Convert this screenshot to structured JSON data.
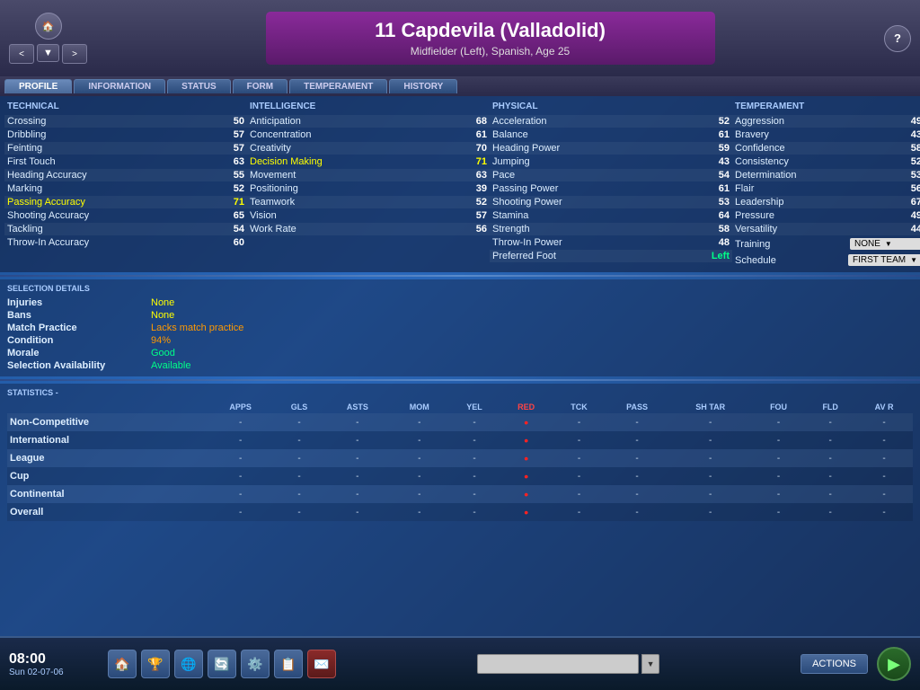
{
  "header": {
    "nav_back": "<",
    "nav_forward": ">",
    "player_number": "11",
    "player_name": "Capdevila (Valladolid)",
    "player_subtitle": "Midfielder (Left), Spanish, Age 25",
    "dropdown_arrow": "▼",
    "help": "?"
  },
  "tabs": {
    "profile": "PROFILE",
    "information": "INFORMATION",
    "status": "STATUS",
    "form": "FORM",
    "temperament": "TEMPERAMENT",
    "history": "HISTORY"
  },
  "technical": {
    "label": "TECHNICAL",
    "stats": [
      {
        "name": "Crossing",
        "value": "50",
        "highlight": false
      },
      {
        "name": "Dribbling",
        "value": "57",
        "highlight": false
      },
      {
        "name": "Feinting",
        "value": "57",
        "highlight": false
      },
      {
        "name": "First Touch",
        "value": "63",
        "highlight": false
      },
      {
        "name": "Heading Accuracy",
        "value": "55",
        "highlight": false
      },
      {
        "name": "Marking",
        "value": "52",
        "highlight": false
      },
      {
        "name": "Passing Accuracy",
        "value": "71",
        "highlight": true
      },
      {
        "name": "Shooting Accuracy",
        "value": "65",
        "highlight": false
      },
      {
        "name": "Tackling",
        "value": "54",
        "highlight": false
      },
      {
        "name": "Throw-In Accuracy",
        "value": "60",
        "highlight": false
      }
    ]
  },
  "intelligence": {
    "label": "INTELLIGENCE",
    "stats": [
      {
        "name": "Anticipation",
        "value": "68",
        "highlight": false
      },
      {
        "name": "Concentration",
        "value": "61",
        "highlight": false
      },
      {
        "name": "Creativity",
        "value": "70",
        "highlight": false
      },
      {
        "name": "Decision Making",
        "value": "71",
        "highlight": true
      },
      {
        "name": "Movement",
        "value": "63",
        "highlight": false
      },
      {
        "name": "Positioning",
        "value": "39",
        "highlight": false
      },
      {
        "name": "Teamwork",
        "value": "52",
        "highlight": false
      },
      {
        "name": "Vision",
        "value": "57",
        "highlight": false
      },
      {
        "name": "Work Rate",
        "value": "56",
        "highlight": false
      }
    ]
  },
  "physical": {
    "label": "PHYSICAL",
    "stats": [
      {
        "name": "Acceleration",
        "value": "52",
        "highlight": false
      },
      {
        "name": "Balance",
        "value": "61",
        "highlight": false
      },
      {
        "name": "Heading Power",
        "value": "59",
        "highlight": false
      },
      {
        "name": "Jumping",
        "value": "43",
        "highlight": false
      },
      {
        "name": "Pace",
        "value": "54",
        "highlight": false
      },
      {
        "name": "Passing Power",
        "value": "61",
        "highlight": false
      },
      {
        "name": "Shooting Power",
        "value": "53",
        "highlight": false
      },
      {
        "name": "Stamina",
        "value": "64",
        "highlight": false
      },
      {
        "name": "Strength",
        "value": "58",
        "highlight": false
      },
      {
        "name": "Throw-In Power",
        "value": "48",
        "highlight": false
      },
      {
        "name": "Preferred Foot",
        "value": "Left",
        "highlight": true,
        "green": true
      }
    ]
  },
  "temperament": {
    "label": "TEMPERAMENT",
    "stats": [
      {
        "name": "Aggression",
        "value": "49"
      },
      {
        "name": "Bravery",
        "value": "43"
      },
      {
        "name": "Confidence",
        "value": "58"
      },
      {
        "name": "Consistency",
        "value": "52"
      },
      {
        "name": "Determination",
        "value": "53"
      },
      {
        "name": "Flair",
        "value": "56"
      },
      {
        "name": "Leadership",
        "value": "67"
      },
      {
        "name": "Pressure",
        "value": "49"
      },
      {
        "name": "Versatility",
        "value": "44"
      }
    ],
    "training_label": "Training",
    "training_value": "NONE",
    "schedule_label": "Schedule",
    "schedule_value": "FIRST TEAM"
  },
  "selection": {
    "section_title": "SELECTION DETAILS",
    "injuries_label": "Injuries",
    "injuries_value": "None",
    "bans_label": "Bans",
    "bans_value": "None",
    "match_practice_label": "Match Practice",
    "match_practice_value": "Lacks match practice",
    "condition_label": "Condition",
    "condition_value": "94%",
    "morale_label": "Morale",
    "morale_value": "Good",
    "availability_label": "Selection Availability",
    "availability_value": "Available"
  },
  "statistics": {
    "section_title": "STATISTICS",
    "section_sub": "-",
    "columns": [
      "APPS",
      "GLS",
      "ASTS",
      "MOM",
      "YEL",
      "RED",
      "TCK",
      "PASS",
      "SH TAR",
      "FOU",
      "FLD",
      "AV R"
    ],
    "rows": [
      {
        "label": "Non-Competitive",
        "values": [
          "-",
          "-",
          "-",
          "-",
          "-",
          "•",
          "-",
          "-",
          "-",
          "-",
          "-",
          "-"
        ]
      },
      {
        "label": "International",
        "values": [
          "-",
          "-",
          "-",
          "-",
          "-",
          "•",
          "-",
          "-",
          "-",
          "-",
          "-",
          "-"
        ]
      },
      {
        "label": "League",
        "values": [
          "-",
          "-",
          "-",
          "-",
          "-",
          "•",
          "-",
          "-",
          "-",
          "-",
          "-",
          "-"
        ]
      },
      {
        "label": "Cup",
        "values": [
          "-",
          "-",
          "-",
          "-",
          "-",
          "•",
          "-",
          "-",
          "-",
          "-",
          "-",
          "-"
        ]
      },
      {
        "label": "Continental",
        "values": [
          "-",
          "-",
          "-",
          "-",
          "-",
          "•",
          "-",
          "-",
          "-",
          "-",
          "-",
          "-"
        ]
      },
      {
        "label": "Overall",
        "values": [
          "-",
          "-",
          "-",
          "-",
          "-",
          "•",
          "-",
          "-",
          "-",
          "-",
          "-",
          "-"
        ]
      }
    ]
  },
  "bottom_bar": {
    "time": "08:00",
    "date": "Sun 02-07-06",
    "actions_label": "ACTIONS",
    "toolbar_icons": [
      "🏠",
      "🏆",
      "🌐",
      "🔄",
      "⚙️",
      "📋",
      "📧"
    ]
  }
}
